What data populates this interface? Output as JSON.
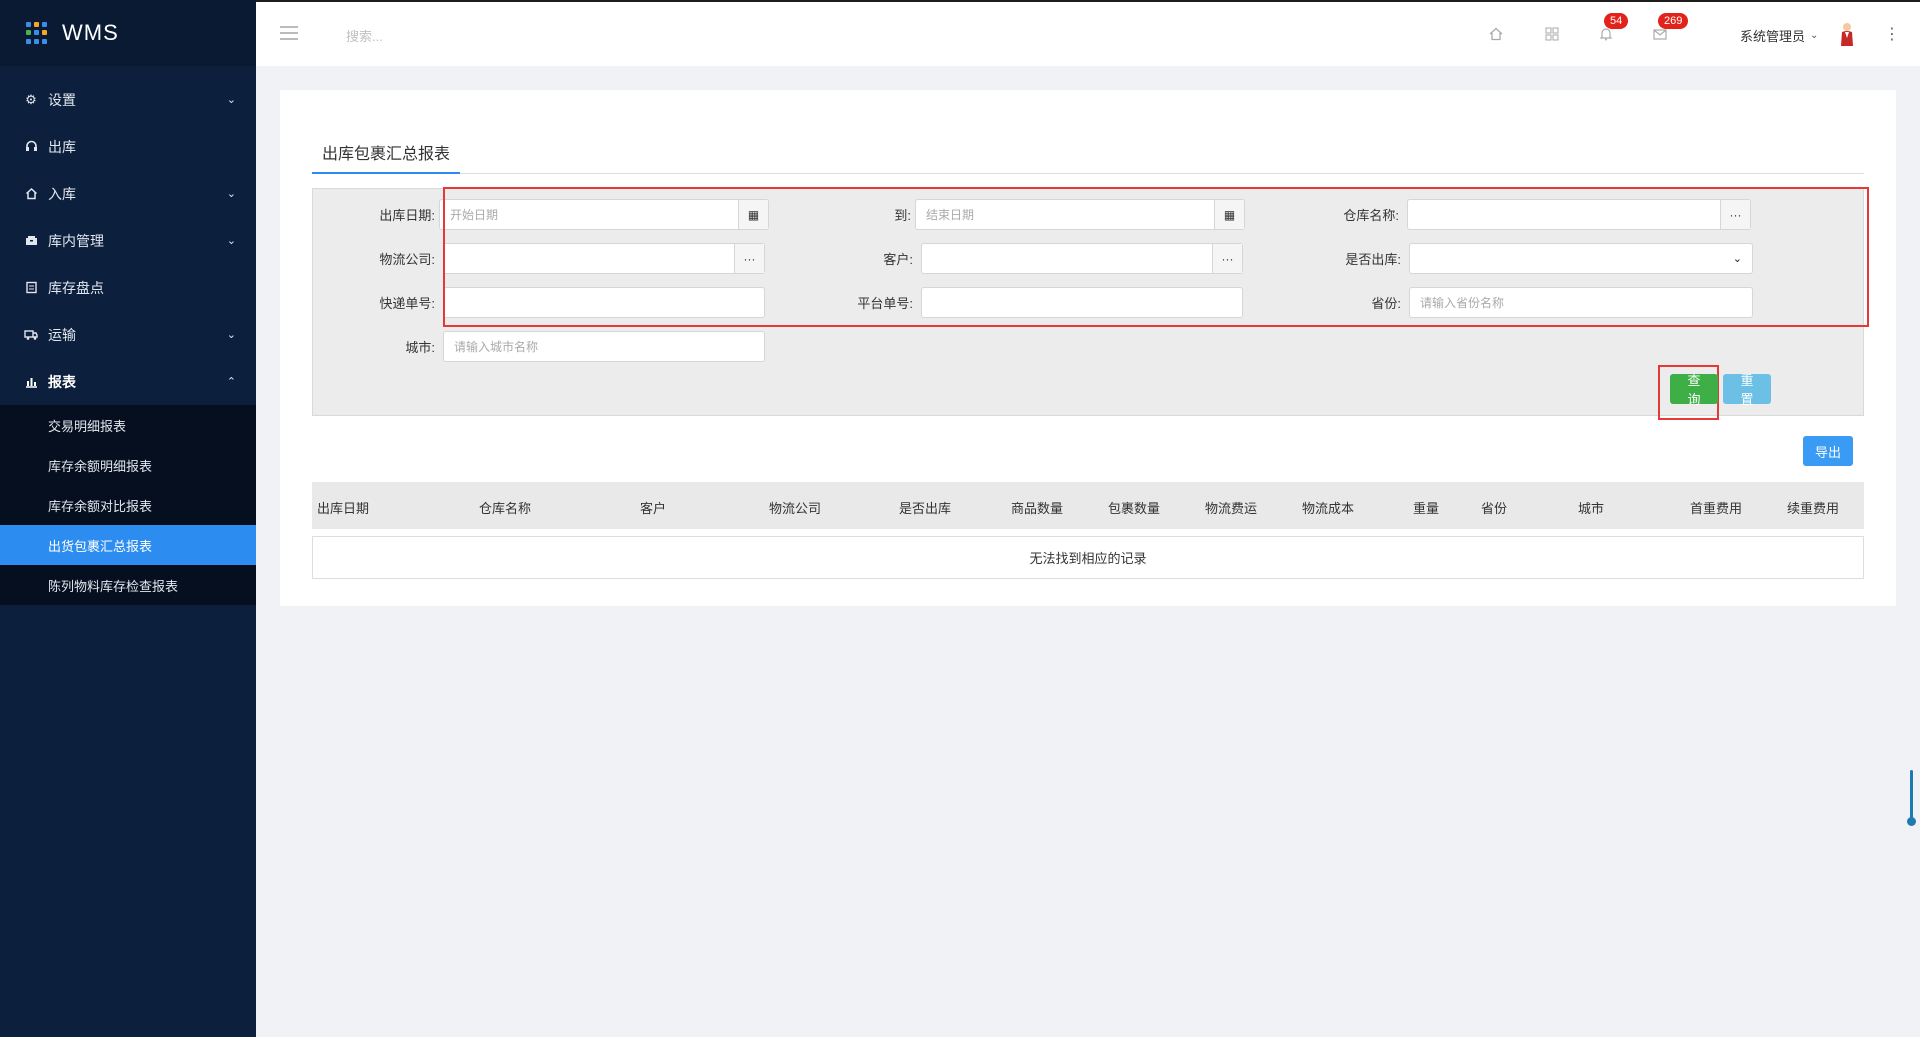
{
  "app": {
    "title": "WMS"
  },
  "sidebar": {
    "items": [
      {
        "label": "设置",
        "icon": "gear-icon",
        "expandable": true
      },
      {
        "label": "出库",
        "icon": "headset-icon",
        "expandable": false
      },
      {
        "label": "入库",
        "icon": "home-icon",
        "expandable": true
      },
      {
        "label": "库内管理",
        "icon": "box-icon",
        "expandable": true
      },
      {
        "label": "库存盘点",
        "icon": "document-icon",
        "expandable": false
      },
      {
        "label": "运输",
        "icon": "truck-icon",
        "expandable": true
      },
      {
        "label": "报表",
        "icon": "bar-chart-icon",
        "expandable": true,
        "open": true
      }
    ],
    "report_submenu": [
      {
        "label": "交易明细报表"
      },
      {
        "label": "库存余额明细报表"
      },
      {
        "label": "库存余额对比报表"
      },
      {
        "label": "出货包裹汇总报表",
        "active": true
      },
      {
        "label": "陈列物料库存检查报表"
      }
    ]
  },
  "topbar": {
    "search_placeholder": "搜索...",
    "notifications_count": "54",
    "messages_count": "269",
    "user_name": "系统管理员"
  },
  "page": {
    "tab_title": "出库包裹汇总报表",
    "filters": {
      "date_from_label": "出库日期:",
      "date_from_placeholder": "开始日期",
      "date_to_label": "到:",
      "date_to_placeholder": "结束日期",
      "warehouse_label": "仓库名称:",
      "logistics_label": "物流公司:",
      "customer_label": "客户:",
      "shipped_label": "是否出库:",
      "tracking_label": "快递单号:",
      "platform_label": "平台单号:",
      "province_label": "省份:",
      "province_placeholder": "请输入省份名称",
      "city_label": "城市:",
      "city_placeholder": "请输入城市名称"
    },
    "buttons": {
      "query": "查询",
      "reset": "重置",
      "export": "导出"
    },
    "table": {
      "columns": [
        "出库日期",
        "仓库名称",
        "客户",
        "物流公司",
        "是否出库",
        "商品数量",
        "包裹数量",
        "物流费运",
        "物流成本",
        "重量",
        "省份",
        "城市",
        "首重费用",
        "续重费用"
      ],
      "empty_text": "无法找到相应的记录"
    }
  }
}
